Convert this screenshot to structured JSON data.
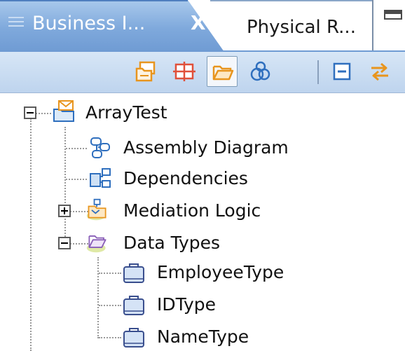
{
  "tabs": {
    "active": {
      "label": "Business I...",
      "close_glyph": "X",
      "icon": "view-grip-icon"
    },
    "inactive": {
      "label": "Physical R..."
    }
  },
  "toolbar": {
    "buttons": [
      {
        "name": "new-module-icon"
      },
      {
        "name": "filter-grid-icon"
      },
      {
        "name": "open-folder-icon"
      },
      {
        "name": "link-circles-icon"
      },
      {
        "name": "collapse-all-icon"
      },
      {
        "name": "sync-arrows-icon"
      }
    ]
  },
  "tree": {
    "root": {
      "label": "ArrayTest",
      "expanded": true
    },
    "items": [
      {
        "label": "Assembly Diagram",
        "icon": "assembly-diagram-icon"
      },
      {
        "label": "Dependencies",
        "icon": "dependencies-icon"
      },
      {
        "label": "Mediation Logic",
        "icon": "mediation-logic-icon",
        "expanded": false
      },
      {
        "label": "Data Types",
        "icon": "data-types-folder-icon",
        "expanded": true
      }
    ],
    "data_types": [
      {
        "label": "EmployeeType"
      },
      {
        "label": "IDType"
      },
      {
        "label": "NameType"
      }
    ]
  },
  "colors": {
    "tab_active": "#7fa9dc",
    "toolbar_bg": "#c8dbf0",
    "icon_orange": "#e8951e",
    "icon_blue": "#2f6fbe"
  }
}
